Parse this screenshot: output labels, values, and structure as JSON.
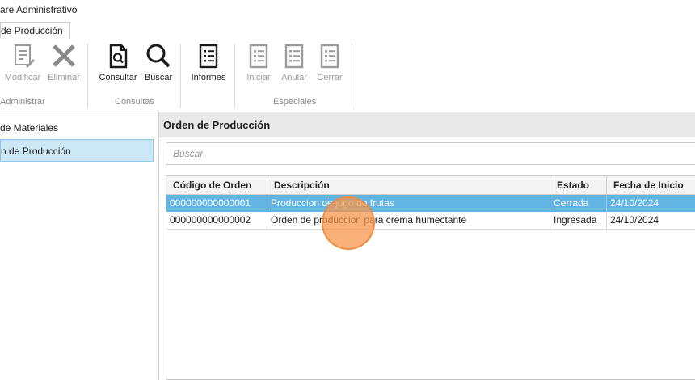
{
  "window": {
    "title": "are Administrativo"
  },
  "tab": {
    "label": "de Producción"
  },
  "ribbon": {
    "buttons": {
      "modificar": {
        "label": "Modificar",
        "icon": "edit-document-icon"
      },
      "eliminar": {
        "label": "Eliminar",
        "icon": "x-icon"
      },
      "consultar": {
        "label": "Consultar",
        "icon": "search-document-icon"
      },
      "buscar": {
        "label": "Buscar",
        "icon": "magnifier-icon"
      },
      "informes": {
        "label": "Informes",
        "icon": "report-icon"
      },
      "iniciar": {
        "label": "Iniciar",
        "icon": "report-icon"
      },
      "anular": {
        "label": "Anular",
        "icon": "report-icon"
      },
      "cerrar": {
        "label": "Cerrar",
        "icon": "report-icon"
      }
    },
    "groups": {
      "administrar": "Administrar",
      "consultas": "Consultas",
      "especiales": "Especiales"
    }
  },
  "sidebar": {
    "items": [
      {
        "label": "de Materiales"
      },
      {
        "label": "n de Producción"
      }
    ]
  },
  "main": {
    "title": "Orden de Producción",
    "search": {
      "placeholder": "Buscar"
    },
    "table": {
      "headers": {
        "codigo": "Código de Orden",
        "descripcion": "Descripción",
        "estado": "Estado",
        "fecha": "Fecha de Inicio"
      },
      "rows": [
        {
          "codigo": "000000000000001",
          "descripcion": "Produccion de jugo de frutas",
          "estado": "Cerrada",
          "fecha": "24/10/2024"
        },
        {
          "codigo": "000000000000002",
          "descripcion": "Orden de produccion para crema humectante",
          "estado": "Ingresada",
          "fecha": "24/10/2024"
        }
      ]
    }
  },
  "colors": {
    "selected_row": "#62b5e3",
    "sidebar_selected": "#cce8f7",
    "click_indicator": "#f5964b"
  }
}
